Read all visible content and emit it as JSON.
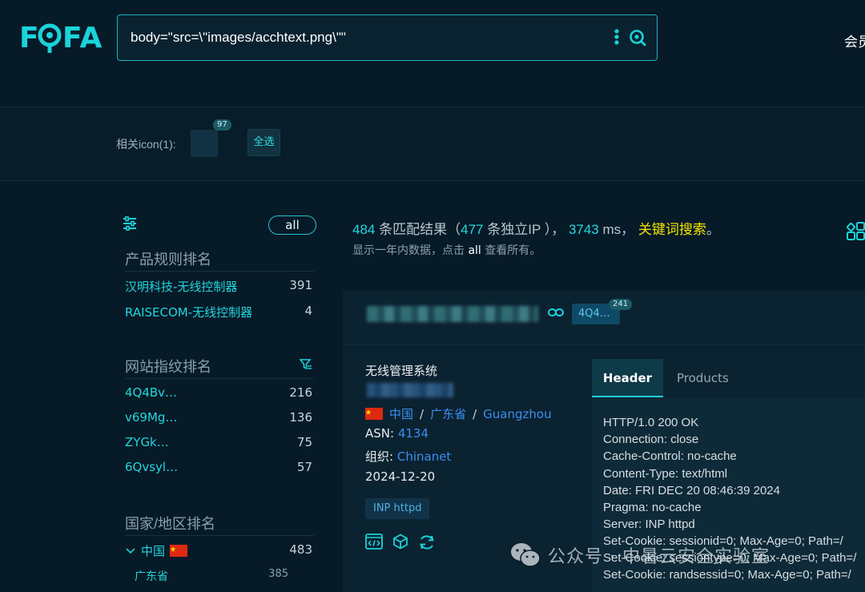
{
  "header": {
    "logo_text": "FOFA",
    "search_query": "body=\"src=\\\"images/acchtext.png\\\"\"",
    "member_label": "会员"
  },
  "iconbar": {
    "label": "相关icon(1):",
    "badge": "97",
    "select_all": "全选"
  },
  "sidebar": {
    "all_label": "all",
    "product_title": "产品规则排名",
    "products": [
      {
        "name": "汉明科技-无线控制器",
        "count": "391"
      },
      {
        "name": "RAISECOM-无线控制器",
        "count": "4"
      }
    ],
    "fingerprint_title": "网站指纹排名",
    "fingerprints": [
      {
        "name": "4Q4Bv…",
        "count": "216"
      },
      {
        "name": "v69Mg…",
        "count": "136"
      },
      {
        "name": "ZYGk…",
        "count": "75"
      },
      {
        "name": "6Qvsyl…",
        "count": "57"
      }
    ],
    "country_title": "国家/地区排名",
    "countries": [
      {
        "name": "中国",
        "count": "483"
      }
    ],
    "regions": [
      {
        "name": "广东省",
        "count": "385"
      }
    ]
  },
  "results": {
    "total": "484",
    "total_label": "条匹配结果（",
    "unique": "477",
    "unique_label": "条独立IP ），",
    "time": "3743",
    "time_unit": "ms，",
    "keyword_search": "关键词搜索",
    "period": "。",
    "sub_prefix": "显示一年内数据，点击",
    "sub_all": "all",
    "sub_suffix": "查看所有。"
  },
  "card": {
    "hash_tag": "4Q4…",
    "hash_badge": "241",
    "title": "无线管理系统",
    "country": "中国",
    "province": "广东省",
    "city": "Guangzhou",
    "asn_label": "ASN:",
    "asn": "4134",
    "org_label": "组织:",
    "org": "Chinanet",
    "date": "2024-12-20",
    "server_tag": "INP httpd",
    "tabs": [
      "Header",
      "Products"
    ],
    "header_lines": [
      "HTTP/1.0 200 OK",
      "Connection: close",
      "Cache-Control: no-cache",
      "Content-Type: text/html",
      "Date: FRI DEC 20 08:46:39 2024",
      "Pragma: no-cache",
      "Server: INP httpd",
      "Set-Cookie: sessionid=0; Max-Age=0; Path=/",
      "Set-Cookie: sessiontype=0; Max-Age=0; Path=/",
      "Set-Cookie: randsessid=0; Max-Age=0; Path=/"
    ]
  },
  "watermark": "公众号 · 中暑云安全实验室",
  "colors": {
    "accent": "#1ad3d9",
    "link": "#3b8ff0",
    "keyword": "#f3e500",
    "background": "#071a27"
  }
}
